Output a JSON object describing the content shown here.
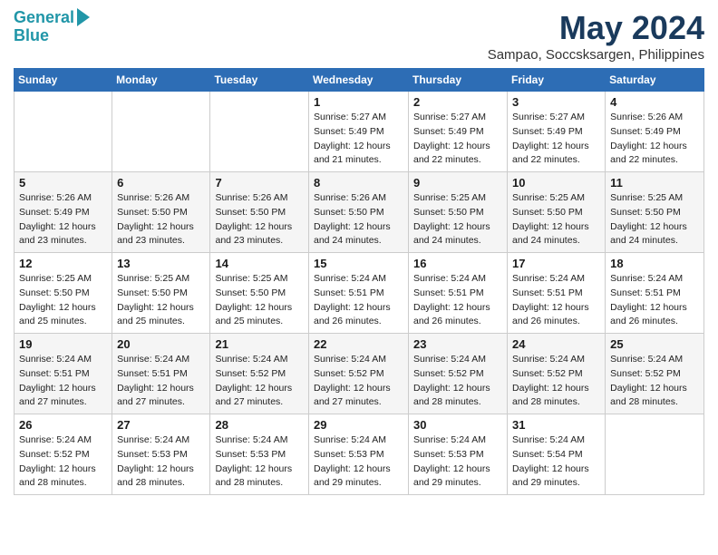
{
  "logo": {
    "line1": "General",
    "line2": "Blue"
  },
  "title": "May 2024",
  "subtitle": "Sampao, Soccsksargen, Philippines",
  "days_of_week": [
    "Sunday",
    "Monday",
    "Tuesday",
    "Wednesday",
    "Thursday",
    "Friday",
    "Saturday"
  ],
  "weeks": [
    [
      {
        "day": "",
        "info": ""
      },
      {
        "day": "",
        "info": ""
      },
      {
        "day": "",
        "info": ""
      },
      {
        "day": "1",
        "info": "Sunrise: 5:27 AM\nSunset: 5:49 PM\nDaylight: 12 hours\nand 21 minutes."
      },
      {
        "day": "2",
        "info": "Sunrise: 5:27 AM\nSunset: 5:49 PM\nDaylight: 12 hours\nand 22 minutes."
      },
      {
        "day": "3",
        "info": "Sunrise: 5:27 AM\nSunset: 5:49 PM\nDaylight: 12 hours\nand 22 minutes."
      },
      {
        "day": "4",
        "info": "Sunrise: 5:26 AM\nSunset: 5:49 PM\nDaylight: 12 hours\nand 22 minutes."
      }
    ],
    [
      {
        "day": "5",
        "info": "Sunrise: 5:26 AM\nSunset: 5:49 PM\nDaylight: 12 hours\nand 23 minutes."
      },
      {
        "day": "6",
        "info": "Sunrise: 5:26 AM\nSunset: 5:50 PM\nDaylight: 12 hours\nand 23 minutes."
      },
      {
        "day": "7",
        "info": "Sunrise: 5:26 AM\nSunset: 5:50 PM\nDaylight: 12 hours\nand 23 minutes."
      },
      {
        "day": "8",
        "info": "Sunrise: 5:26 AM\nSunset: 5:50 PM\nDaylight: 12 hours\nand 24 minutes."
      },
      {
        "day": "9",
        "info": "Sunrise: 5:25 AM\nSunset: 5:50 PM\nDaylight: 12 hours\nand 24 minutes."
      },
      {
        "day": "10",
        "info": "Sunrise: 5:25 AM\nSunset: 5:50 PM\nDaylight: 12 hours\nand 24 minutes."
      },
      {
        "day": "11",
        "info": "Sunrise: 5:25 AM\nSunset: 5:50 PM\nDaylight: 12 hours\nand 24 minutes."
      }
    ],
    [
      {
        "day": "12",
        "info": "Sunrise: 5:25 AM\nSunset: 5:50 PM\nDaylight: 12 hours\nand 25 minutes."
      },
      {
        "day": "13",
        "info": "Sunrise: 5:25 AM\nSunset: 5:50 PM\nDaylight: 12 hours\nand 25 minutes."
      },
      {
        "day": "14",
        "info": "Sunrise: 5:25 AM\nSunset: 5:50 PM\nDaylight: 12 hours\nand 25 minutes."
      },
      {
        "day": "15",
        "info": "Sunrise: 5:24 AM\nSunset: 5:51 PM\nDaylight: 12 hours\nand 26 minutes."
      },
      {
        "day": "16",
        "info": "Sunrise: 5:24 AM\nSunset: 5:51 PM\nDaylight: 12 hours\nand 26 minutes."
      },
      {
        "day": "17",
        "info": "Sunrise: 5:24 AM\nSunset: 5:51 PM\nDaylight: 12 hours\nand 26 minutes."
      },
      {
        "day": "18",
        "info": "Sunrise: 5:24 AM\nSunset: 5:51 PM\nDaylight: 12 hours\nand 26 minutes."
      }
    ],
    [
      {
        "day": "19",
        "info": "Sunrise: 5:24 AM\nSunset: 5:51 PM\nDaylight: 12 hours\nand 27 minutes."
      },
      {
        "day": "20",
        "info": "Sunrise: 5:24 AM\nSunset: 5:51 PM\nDaylight: 12 hours\nand 27 minutes."
      },
      {
        "day": "21",
        "info": "Sunrise: 5:24 AM\nSunset: 5:52 PM\nDaylight: 12 hours\nand 27 minutes."
      },
      {
        "day": "22",
        "info": "Sunrise: 5:24 AM\nSunset: 5:52 PM\nDaylight: 12 hours\nand 27 minutes."
      },
      {
        "day": "23",
        "info": "Sunrise: 5:24 AM\nSunset: 5:52 PM\nDaylight: 12 hours\nand 28 minutes."
      },
      {
        "day": "24",
        "info": "Sunrise: 5:24 AM\nSunset: 5:52 PM\nDaylight: 12 hours\nand 28 minutes."
      },
      {
        "day": "25",
        "info": "Sunrise: 5:24 AM\nSunset: 5:52 PM\nDaylight: 12 hours\nand 28 minutes."
      }
    ],
    [
      {
        "day": "26",
        "info": "Sunrise: 5:24 AM\nSunset: 5:52 PM\nDaylight: 12 hours\nand 28 minutes."
      },
      {
        "day": "27",
        "info": "Sunrise: 5:24 AM\nSunset: 5:53 PM\nDaylight: 12 hours\nand 28 minutes."
      },
      {
        "day": "28",
        "info": "Sunrise: 5:24 AM\nSunset: 5:53 PM\nDaylight: 12 hours\nand 28 minutes."
      },
      {
        "day": "29",
        "info": "Sunrise: 5:24 AM\nSunset: 5:53 PM\nDaylight: 12 hours\nand 29 minutes."
      },
      {
        "day": "30",
        "info": "Sunrise: 5:24 AM\nSunset: 5:53 PM\nDaylight: 12 hours\nand 29 minutes."
      },
      {
        "day": "31",
        "info": "Sunrise: 5:24 AM\nSunset: 5:54 PM\nDaylight: 12 hours\nand 29 minutes."
      },
      {
        "day": "",
        "info": ""
      }
    ]
  ]
}
